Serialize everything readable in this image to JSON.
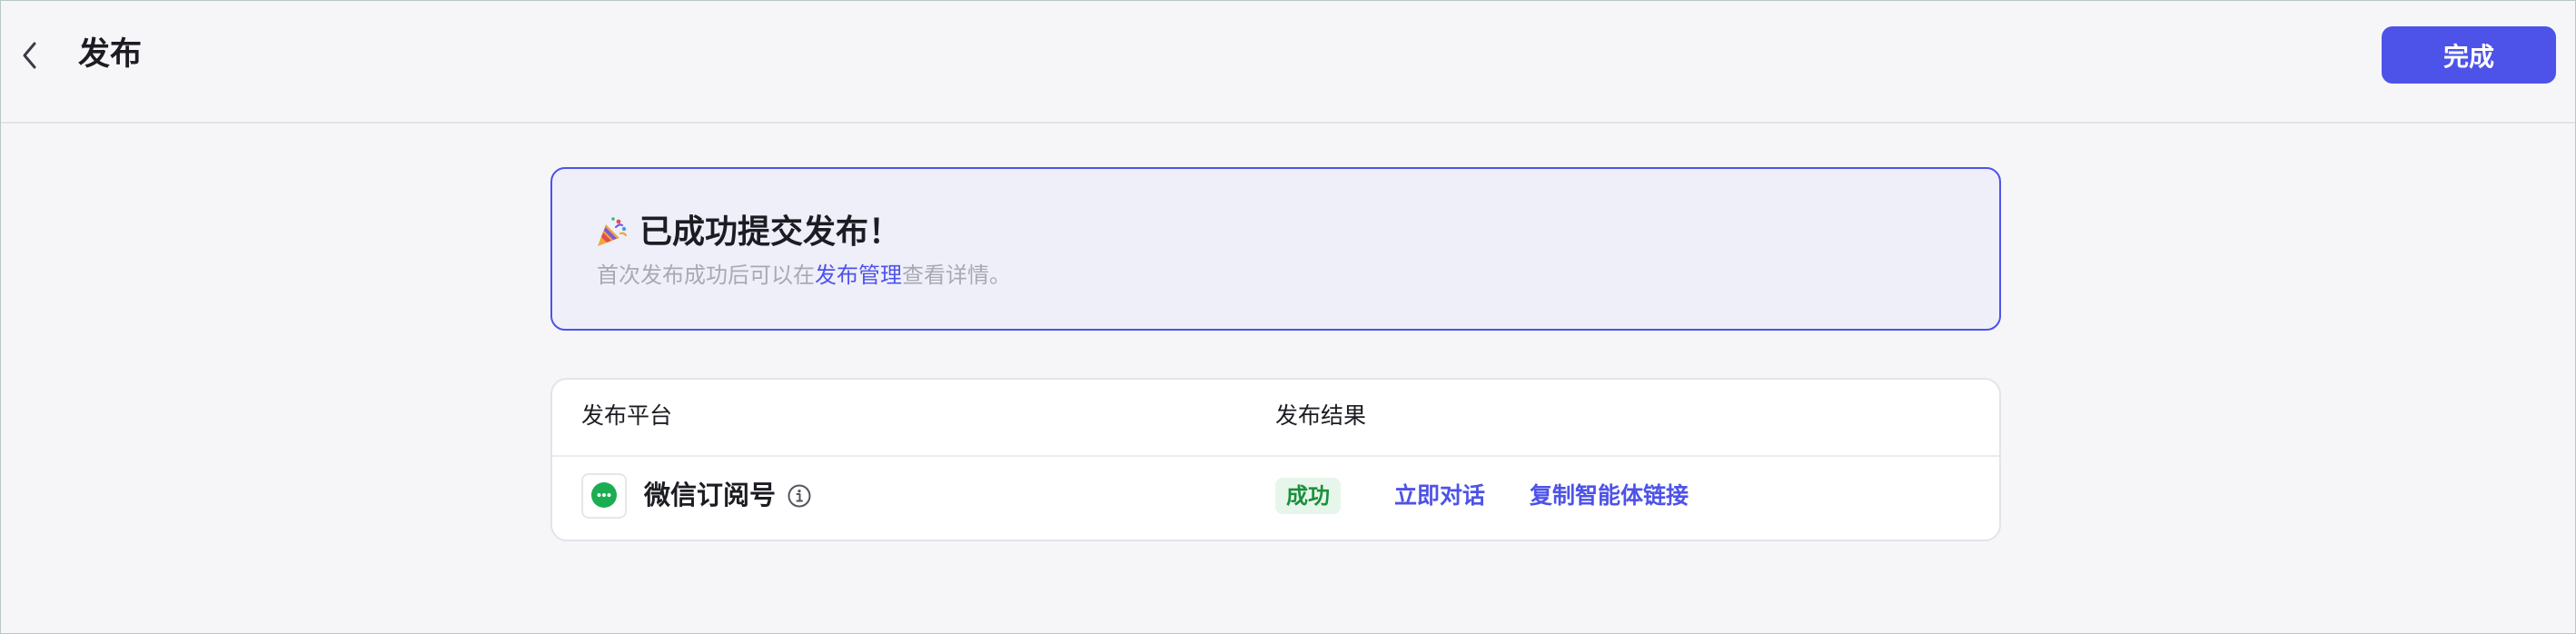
{
  "header": {
    "title": "发布",
    "done_label": "完成"
  },
  "success": {
    "title": "已成功提交发布！",
    "desc_prefix": "首次发布成功后可以在",
    "desc_link": "发布管理",
    "desc_suffix": "查看详情。"
  },
  "table": {
    "columns": [
      "发布平台",
      "发布结果"
    ],
    "rows": [
      {
        "platform": "微信订阅号",
        "status": "成功",
        "actions": [
          "立即对话",
          "复制智能体链接"
        ]
      }
    ]
  },
  "icons": {
    "back": "chevron-left-icon",
    "celebrate": "party-popper-icon",
    "platform": "wechat-icon",
    "info": "info-icon"
  },
  "colors": {
    "accent": "#4d53e8",
    "success_text": "#1a8f3c",
    "success_bg": "#e7f6ea",
    "wechat": "#1aad52"
  }
}
